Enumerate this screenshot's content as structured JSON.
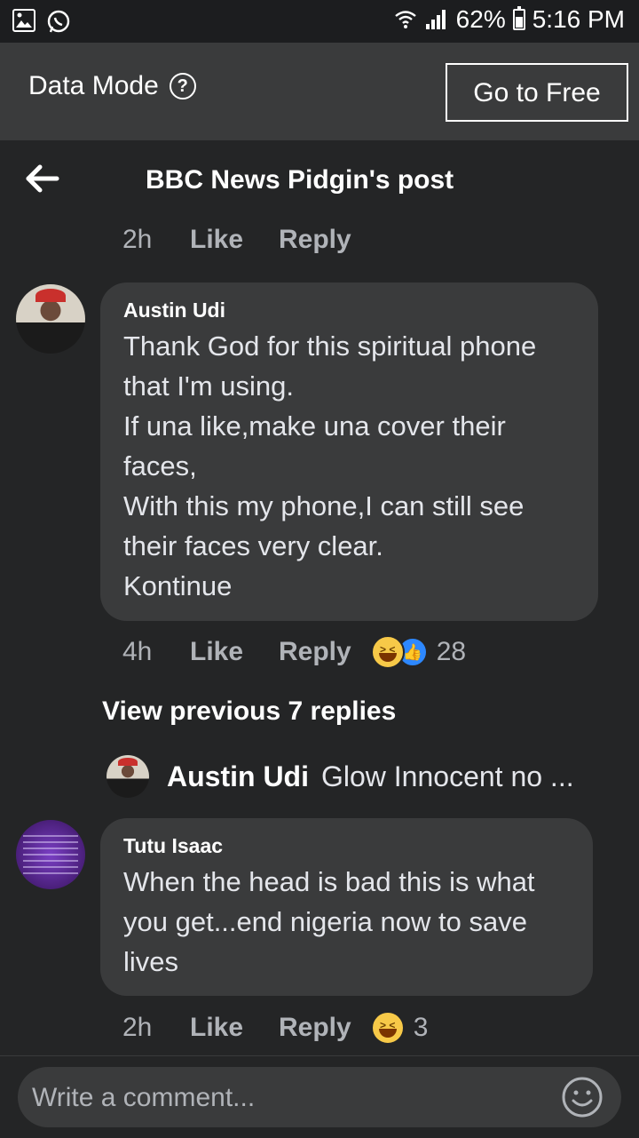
{
  "status_bar": {
    "battery": "62%",
    "time": "5:16 PM"
  },
  "data_mode": {
    "label": "Data Mode",
    "help": "?",
    "go_free": "Go to Free"
  },
  "header": {
    "title": "BBC News Pidgin's post"
  },
  "post_actions": {
    "time": "2h",
    "like": "Like",
    "reply": "Reply"
  },
  "comments": [
    {
      "author": "Austin Udi",
      "text": "Thank God for this spiritual phone\nthat I'm using.\nIf una like,make una cover their\nfaces,\nWith this my phone,I can still see\ntheir faces very clear.\nKontinue",
      "time": "4h",
      "like": "Like",
      "reply": "Reply",
      "reactions": "28",
      "view_previous": "View previous 7 replies",
      "reply_preview": {
        "author": "Austin Udi",
        "text": "Glow Innocent no ..."
      }
    },
    {
      "author": "Tutu Isaac",
      "text": "When the head is bad this is what\nyou get...end nigeria now to save\nlives",
      "time": "2h",
      "like": "Like",
      "reply": "Reply",
      "reactions": "3"
    }
  ],
  "composer": {
    "placeholder": "Write a comment..."
  }
}
